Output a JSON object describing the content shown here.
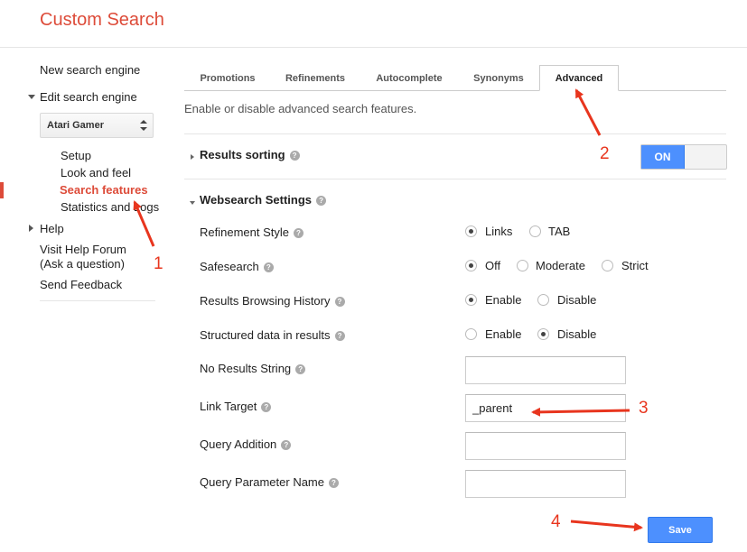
{
  "header": {
    "title": "Custom Search"
  },
  "sidebar": {
    "new_engine": "New search engine",
    "edit_engine": "Edit search engine",
    "selected_engine": "Atari Gamer",
    "sub_items": [
      "Setup",
      "Look and feel",
      "Search features",
      "Statistics and Logs"
    ],
    "help": "Help",
    "help_forum": "Visit Help Forum",
    "ask_question": "(Ask a question)",
    "send_feedback": "Send Feedback"
  },
  "tabs": [
    "Promotions",
    "Refinements",
    "Autocomplete",
    "Synonyms",
    "Advanced"
  ],
  "active_tab": "Advanced",
  "description": "Enable or disable advanced search features.",
  "results_sorting": {
    "title": "Results sorting",
    "toggle": "ON"
  },
  "websearch": {
    "title": "Websearch Settings",
    "refinement_style": {
      "label": "Refinement Style",
      "options": [
        "Links",
        "TAB"
      ],
      "selected": "Links"
    },
    "safesearch": {
      "label": "Safesearch",
      "options": [
        "Off",
        "Moderate",
        "Strict"
      ],
      "selected": "Off"
    },
    "browsing_history": {
      "label": "Results Browsing History",
      "options": [
        "Enable",
        "Disable"
      ],
      "selected": "Enable"
    },
    "structured_data": {
      "label": "Structured data in results",
      "options": [
        "Enable",
        "Disable"
      ],
      "selected": "Disable"
    },
    "no_results": {
      "label": "No Results String",
      "value": ""
    },
    "link_target": {
      "label": "Link Target",
      "value": "_parent"
    },
    "query_addition": {
      "label": "Query Addition",
      "value": ""
    },
    "query_param": {
      "label": "Query Parameter Name",
      "value": ""
    }
  },
  "save_label": "Save",
  "help_glyph": "?",
  "annotations": [
    "1",
    "2",
    "3",
    "4"
  ],
  "colors": {
    "accent_red": "#dd4b39",
    "primary_blue": "#4d90fe",
    "callout_red": "#e8351e"
  }
}
